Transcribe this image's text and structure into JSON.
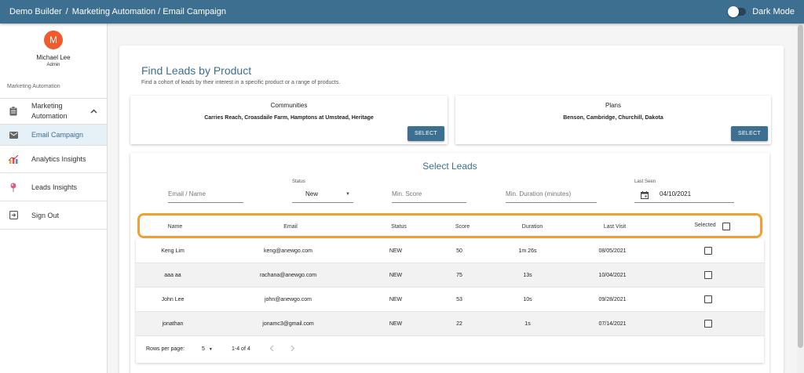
{
  "topbar": {
    "crumb_home": "Demo Builder",
    "crumb_sep": "/",
    "crumb_path": "Marketing Automation / Email Campaign",
    "dark_mode_label": "Dark Mode"
  },
  "sidebar": {
    "avatar_initial": "M",
    "user_name": "Michael Lee",
    "user_role": "Admin",
    "section_label": "Marketing Automation",
    "items": [
      {
        "label": "Marketing Automation",
        "icon": "clipboard-icon"
      },
      {
        "label": "Email Campaign",
        "icon": "mail-icon"
      },
      {
        "label": "Analytics Insights",
        "icon": "chart-icon"
      },
      {
        "label": "Leads Insights",
        "icon": "pin-icon"
      },
      {
        "label": "Sign Out",
        "icon": "exit-icon"
      }
    ]
  },
  "main": {
    "title": "Find Leads by Product",
    "subtitle": "Find a cohort of leads by their interest in a specific product or a range of products.",
    "communities": {
      "title": "Communities",
      "value": "Carries Reach, Croasdaile Farm, Hamptons at Umstead, Heritage",
      "button": "SELECT"
    },
    "plans": {
      "title": "Plans",
      "value": "Benson, Cambridge, Churchill, Dakota",
      "button": "SELECT"
    }
  },
  "leads": {
    "title": "Select Leads",
    "filters": {
      "email_placeholder": "Email / Name",
      "status_label": "Status",
      "status_value": "New",
      "score_placeholder": "Min. Score",
      "duration_placeholder": "Min. Duration (minutes)",
      "last_seen_label": "Last Seen",
      "last_seen_value": "04/10/2021"
    },
    "columns": [
      "Name",
      "Email",
      "Status",
      "Score",
      "Duration",
      "Last Visit",
      "Selected"
    ],
    "rows": [
      {
        "name": "Keng Lim",
        "email": "keng@anewgo.com",
        "status": "NEW",
        "score": "50",
        "duration": "1m 26s",
        "last_visit": "08/05/2021"
      },
      {
        "name": "aaa aa",
        "email": "rachana@anewgo.com",
        "status": "NEW",
        "score": "75",
        "duration": "13s",
        "last_visit": "10/04/2021"
      },
      {
        "name": "John Lee",
        "email": "john@anewgo.com",
        "status": "NEW",
        "score": "53",
        "duration": "10s",
        "last_visit": "09/28/2021"
      },
      {
        "name": "jonathan",
        "email": "jonamc3@gmail.com",
        "status": "NEW",
        "score": "22",
        "duration": "1s",
        "last_visit": "07/14/2021"
      }
    ],
    "pager": {
      "rows_per_page_label": "Rows per page:",
      "rows_per_page_value": "5",
      "range": "1-4 of 4"
    }
  }
}
